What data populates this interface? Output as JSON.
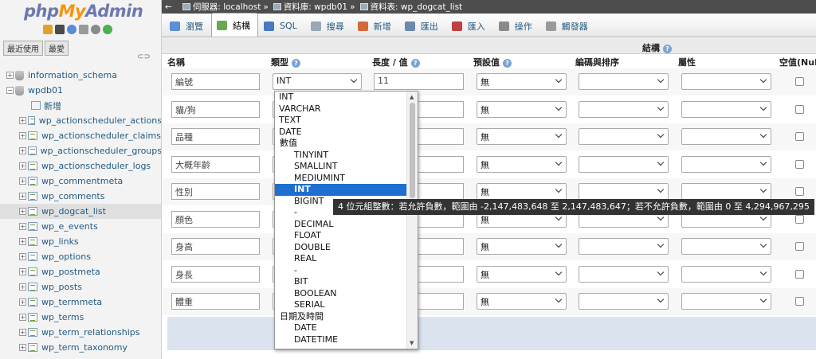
{
  "sidebar": {
    "logo": {
      "php": "php",
      "my": "My",
      "admin": "Admin"
    },
    "recent_tab": "最近使用",
    "favorites_tab": "最愛",
    "tree": [
      {
        "label": "information_schema",
        "kind": "db",
        "expander": "+"
      },
      {
        "label": "wpdb01",
        "kind": "db",
        "expander": "−"
      },
      {
        "label": "新增",
        "kind": "new"
      },
      {
        "label": "wp_actionscheduler_actions",
        "kind": "table"
      },
      {
        "label": "wp_actionscheduler_claims",
        "kind": "table"
      },
      {
        "label": "wp_actionscheduler_groups",
        "kind": "table"
      },
      {
        "label": "wp_actionscheduler_logs",
        "kind": "table"
      },
      {
        "label": "wp_commentmeta",
        "kind": "table"
      },
      {
        "label": "wp_comments",
        "kind": "table"
      },
      {
        "label": "wp_dogcat_list",
        "kind": "table",
        "selected": true
      },
      {
        "label": "wp_e_events",
        "kind": "table"
      },
      {
        "label": "wp_links",
        "kind": "table"
      },
      {
        "label": "wp_options",
        "kind": "table"
      },
      {
        "label": "wp_postmeta",
        "kind": "table"
      },
      {
        "label": "wp_posts",
        "kind": "table"
      },
      {
        "label": "wp_termmeta",
        "kind": "table"
      },
      {
        "label": "wp_terms",
        "kind": "table"
      },
      {
        "label": "wp_term_relationships",
        "kind": "table"
      },
      {
        "label": "wp_term_taxonomy",
        "kind": "table"
      }
    ]
  },
  "breadcrumb": {
    "server": "伺服器: localhost",
    "database": "資料庫: wpdb01",
    "table": "資料表: wp_dogcat_list",
    "sep": "»"
  },
  "tabs": [
    {
      "label": "瀏覽",
      "icon": "browse-icon",
      "color": "#5b8fd6"
    },
    {
      "label": "結構",
      "icon": "structure-icon",
      "color": "#6aa84f",
      "active": true
    },
    {
      "label": "SQL",
      "icon": "sql-icon",
      "color": "#4a78c2"
    },
    {
      "label": "搜尋",
      "icon": "search-icon",
      "color": "#9aa8b8"
    },
    {
      "label": "新增",
      "icon": "insert-icon",
      "color": "#d46a3a"
    },
    {
      "label": "匯出",
      "icon": "export-icon",
      "color": "#6c8ab0"
    },
    {
      "label": "匯入",
      "icon": "import-icon",
      "color": "#c04040"
    },
    {
      "label": "操作",
      "icon": "wrench-icon",
      "color": "#8a8a8a"
    },
    {
      "label": "觸發器",
      "icon": "trigger-icon",
      "color": "#9a9a9a"
    }
  ],
  "structure": {
    "title": "結構",
    "columns": {
      "name": "名稱",
      "type": "類型",
      "length": "長度 / 值",
      "default": "預設值",
      "collation": "編碼與排序",
      "attributes": "屬性",
      "null": "空值(Null)"
    },
    "rows": [
      {
        "name": "編號",
        "type": "INT",
        "length": "11",
        "default": "無"
      },
      {
        "name": "貓/狗",
        "type": "",
        "length": "",
        "default": "無"
      },
      {
        "name": "品種",
        "type": "",
        "length": "",
        "default": "無"
      },
      {
        "name": "大概年齡",
        "type": "",
        "length": "",
        "default": "無"
      },
      {
        "name": "性別",
        "type": "",
        "length": "",
        "default": "無"
      },
      {
        "name": "顏色",
        "type": "",
        "length": "",
        "default": "無"
      },
      {
        "name": "身高",
        "type": "",
        "length": "",
        "default": "無"
      },
      {
        "name": "身長",
        "type": "",
        "length": "",
        "default": "無"
      },
      {
        "name": "體重",
        "type": "",
        "length": "",
        "default": "無"
      }
    ]
  },
  "type_dropdown": {
    "items": [
      {
        "label": "INT",
        "level": "top"
      },
      {
        "label": "VARCHAR",
        "level": "top"
      },
      {
        "label": "TEXT",
        "level": "top"
      },
      {
        "label": "DATE",
        "level": "top"
      },
      {
        "label": "數值",
        "level": "group"
      },
      {
        "label": "TINYINT",
        "level": "sub"
      },
      {
        "label": "SMALLINT",
        "level": "sub"
      },
      {
        "label": "MEDIUMINT",
        "level": "sub"
      },
      {
        "label": "INT",
        "level": "sub",
        "highlighted": true
      },
      {
        "label": "BIGINT",
        "level": "sub"
      },
      {
        "label": "-",
        "level": "sub"
      },
      {
        "label": "DECIMAL",
        "level": "sub"
      },
      {
        "label": "FLOAT",
        "level": "sub"
      },
      {
        "label": "DOUBLE",
        "level": "sub"
      },
      {
        "label": "REAL",
        "level": "sub"
      },
      {
        "label": "-",
        "level": "sub"
      },
      {
        "label": "BIT",
        "level": "sub"
      },
      {
        "label": "BOOLEAN",
        "level": "sub"
      },
      {
        "label": "SERIAL",
        "level": "sub"
      },
      {
        "label": "日期及時間",
        "level": "group"
      },
      {
        "label": "DATE",
        "level": "sub"
      },
      {
        "label": "DATETIME",
        "level": "sub"
      }
    ]
  },
  "tooltip": "4 位元組整數：若允許負數，範圍由 -2,147,483,648 至 2,147,483,647；若不允許負數，範圍由 0 至 4,294,967,295"
}
